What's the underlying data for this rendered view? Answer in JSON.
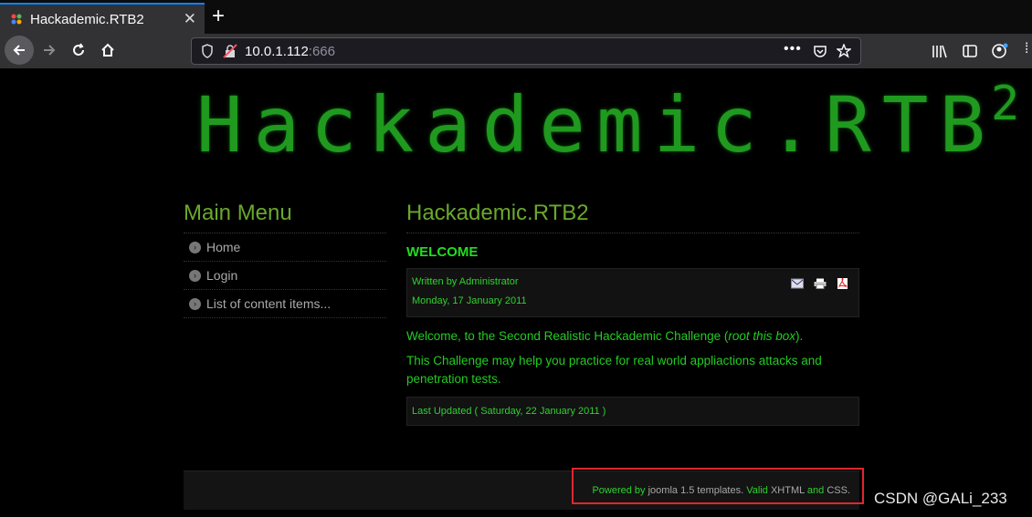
{
  "browser": {
    "tab_title": "Hackademic.RTB2",
    "url_host": "10.0.1.112",
    "url_port": ":666"
  },
  "site": {
    "banner_text": "Hackademic.RTB",
    "banner_sup": "2"
  },
  "sidebar": {
    "title": "Main Menu",
    "items": [
      {
        "label": "Home"
      },
      {
        "label": "Login"
      },
      {
        "label": "List of content items..."
      }
    ]
  },
  "article": {
    "title": "Hackademic.RTB2",
    "heading": "WELCOME",
    "author": "Written by Administrator",
    "date": "Monday, 17 January 2011",
    "para1_prefix": "Welcome, to the Second Realistic Hackademic Challenge (",
    "para1_em": "root this box",
    "para1_suffix": ").",
    "para2": "This Challenge may help you practice for real world appliactions attacks and penetration tests.",
    "updated": "Last Updated ( Saturday, 22 January 2011 )"
  },
  "footer": {
    "powered_by": "Powered by",
    "joomla": "joomla 1.5 templates",
    "dot": ".",
    "valid": "Valid",
    "xhtml": "XHTML",
    "and": "and",
    "css": "CSS",
    "end": "."
  },
  "watermark": "CSDN @GALi_233",
  "colors": {
    "accent_green": "#22cc22",
    "title_green": "#6aa82d",
    "highlight_red": "#e0262f"
  }
}
